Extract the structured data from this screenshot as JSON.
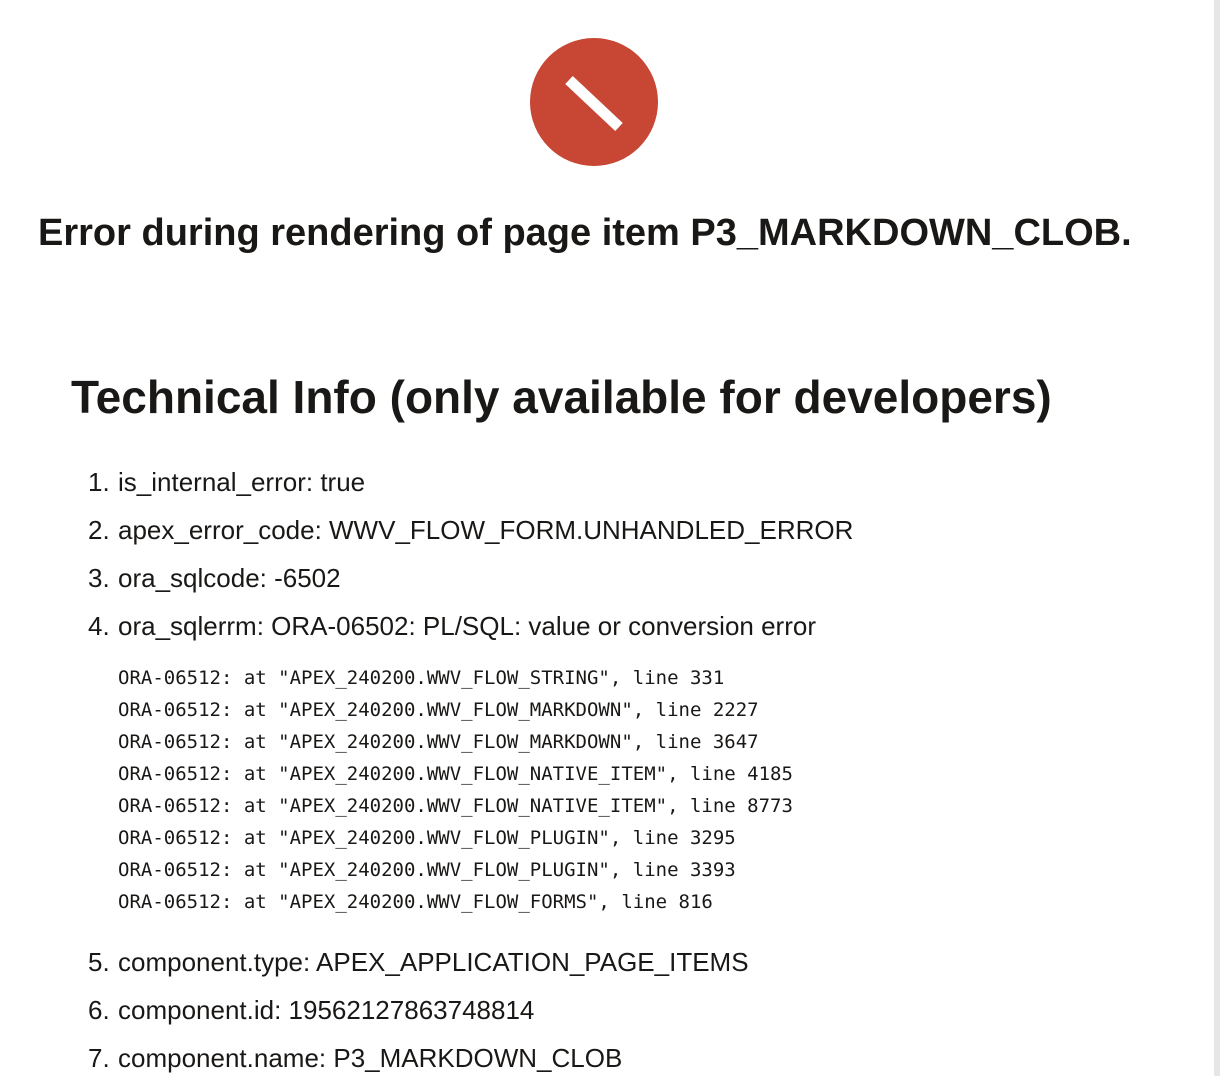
{
  "error": {
    "icon": "prohibited-icon",
    "icon_color": "#c74634",
    "title": "Error during rendering of page item P3_MARKDOWN_CLOB."
  },
  "technical_info": {
    "heading": "Technical Info (only available for developers)",
    "items": [
      {
        "num": "1.",
        "text": "is_internal_error: true"
      },
      {
        "num": "2.",
        "text": "apex_error_code: WWV_FLOW_FORM.UNHANDLED_ERROR"
      },
      {
        "num": "3.",
        "text": "ora_sqlcode: -6502"
      },
      {
        "num": "4.",
        "text": "ora_sqlerrm: ORA-06502: PL/SQL: value or conversion error"
      },
      {
        "num": "5.",
        "text": "component.type: APEX_APPLICATION_PAGE_ITEMS"
      },
      {
        "num": "6.",
        "text": "component.id: 19562127863748814"
      },
      {
        "num": "7.",
        "text": "component.name: P3_MARKDOWN_CLOB"
      }
    ],
    "stack": [
      "ORA-06512: at \"APEX_240200.WWV_FLOW_STRING\", line 331",
      "ORA-06512: at \"APEX_240200.WWV_FLOW_MARKDOWN\", line 2227",
      "ORA-06512: at \"APEX_240200.WWV_FLOW_MARKDOWN\", line 3647",
      "ORA-06512: at \"APEX_240200.WWV_FLOW_NATIVE_ITEM\", line 4185",
      "ORA-06512: at \"APEX_240200.WWV_FLOW_NATIVE_ITEM\", line 8773",
      "ORA-06512: at \"APEX_240200.WWV_FLOW_PLUGIN\", line 3295",
      "ORA-06512: at \"APEX_240200.WWV_FLOW_PLUGIN\", line 3393",
      "ORA-06512: at \"APEX_240200.WWV_FLOW_FORMS\", line 816"
    ]
  }
}
